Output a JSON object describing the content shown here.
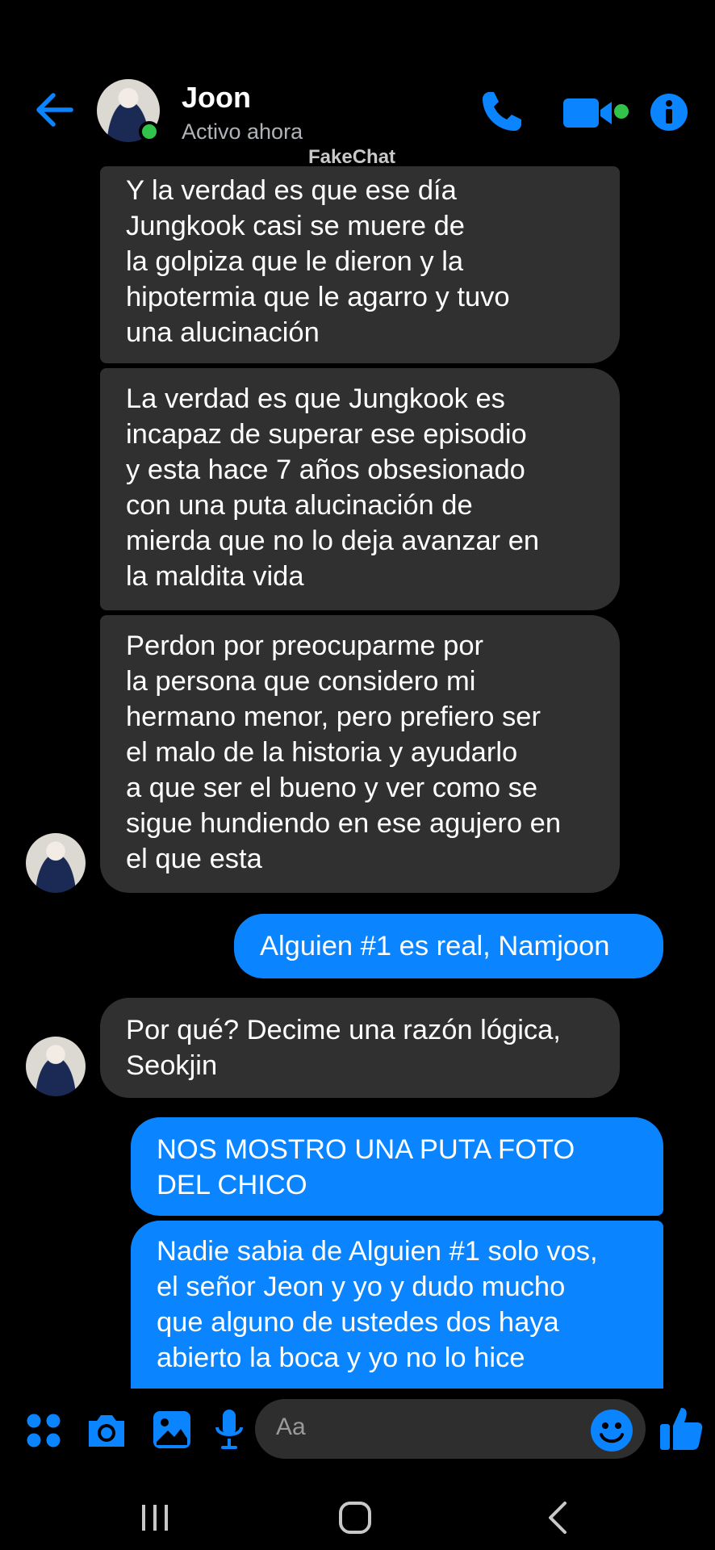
{
  "header": {
    "contact_name": "Joon",
    "status": "Activo ahora",
    "watermark": "FakeChat"
  },
  "messages": [
    {
      "direction": "in",
      "lines": [
        "Y la verdad es que ese día",
        "Jungkook casi se muere de",
        "la golpiza que le dieron y la",
        "hipotermia que le agarro y tuvo",
        "una alucinación"
      ]
    },
    {
      "direction": "in",
      "lines": [
        "La verdad es que Jungkook es",
        "incapaz de superar ese episodio",
        "y esta hace 7 años obsesionado",
        "con una puta alucinación de",
        "mierda que no lo deja avanzar en",
        "la maldita vida"
      ]
    },
    {
      "direction": "in",
      "lines": [
        "Perdon por preocuparme por",
        "la persona que considero mi",
        "hermano menor, pero prefiero ser",
        "el malo de la historia y ayudarlo",
        "a que ser el bueno y ver como se",
        "sigue hundiendo en ese agujero en",
        "el que esta"
      ]
    },
    {
      "direction": "out",
      "lines": [
        "Alguien #1 es real, Namjoon"
      ]
    },
    {
      "direction": "in",
      "lines": [
        "Por qué? Decime una razón lógica,",
        "Seokjin"
      ]
    },
    {
      "direction": "out",
      "lines": [
        "NOS MOSTRO UNA PUTA FOTO",
        "DEL CHICO"
      ]
    },
    {
      "direction": "out",
      "lines": [
        "Nadie sabia de Alguien #1 solo vos,",
        "el señor Jeon y yo y dudo mucho",
        "que alguno de ustedes dos haya",
        "abierto la boca y yo no lo hice"
      ]
    }
  ],
  "composer": {
    "placeholder": "Aa",
    "icons": [
      "apps-icon",
      "camera-icon",
      "gallery-icon",
      "microphone-icon",
      "emoji-icon",
      "like-icon"
    ]
  },
  "colors": {
    "accent": "#0a84ff",
    "incoming_bubble": "#303030",
    "online": "#31c34a"
  }
}
